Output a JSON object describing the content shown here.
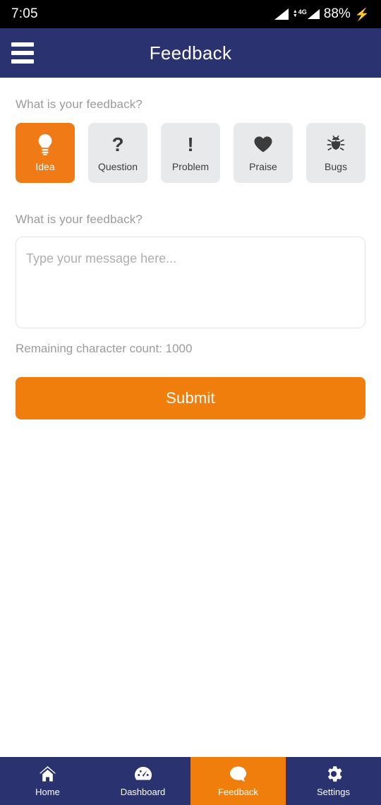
{
  "statusbar": {
    "time": "7:05",
    "network_label": "4G",
    "battery": "88%",
    "charging_icon": "lightning-bolt-icon",
    "signal_icon": "signal-bars-icon"
  },
  "header": {
    "title": "Feedback",
    "menu_icon": "hamburger-menu-icon",
    "background_color": "#2a3270"
  },
  "form": {
    "category_label": "What is your feedback?",
    "message_label": "What is your feedback?",
    "categories": [
      {
        "label": "Idea",
        "icon": "lightbulb-icon",
        "selected": true
      },
      {
        "label": "Question",
        "icon": "question-mark-icon",
        "selected": false
      },
      {
        "label": "Problem",
        "icon": "exclamation-mark-icon",
        "selected": false
      },
      {
        "label": "Praise",
        "icon": "heart-icon",
        "selected": false
      },
      {
        "label": "Bugs",
        "icon": "bug-icon",
        "selected": false
      }
    ],
    "message_value": "",
    "message_placeholder": "Type your message here...",
    "char_count_text": "Remaining character count: 1000",
    "submit_label": "Submit",
    "accent_color": "#f07e0c"
  },
  "bottom_nav": [
    {
      "label": "Home",
      "icon": "home-icon",
      "active": false
    },
    {
      "label": "Dashboard",
      "icon": "speedometer-icon",
      "active": false
    },
    {
      "label": "Feedback",
      "icon": "chat-bubble-icon",
      "active": true
    },
    {
      "label": "Settings",
      "icon": "gear-icon",
      "active": false
    }
  ]
}
